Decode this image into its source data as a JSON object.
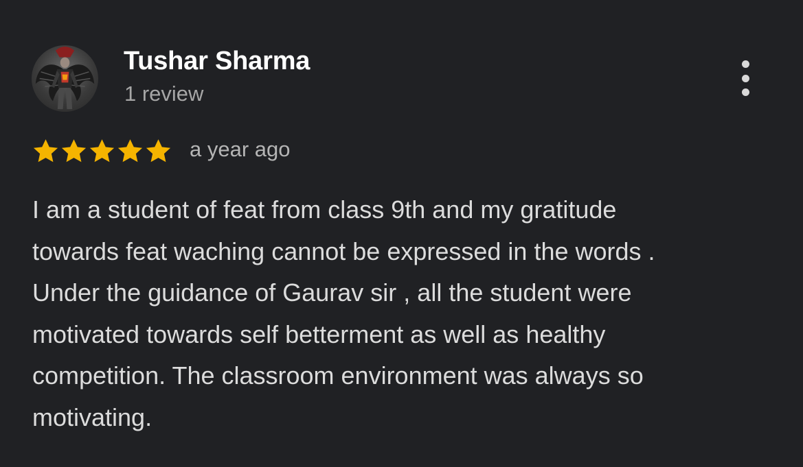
{
  "author": {
    "name": "Tushar Sharma",
    "review_count": "1 review"
  },
  "rating": {
    "stars": 5,
    "max_stars": 5,
    "star_color": "#f5b400"
  },
  "review": {
    "date": "a year ago",
    "lines": [
      "I am a student of feat from class 9th and my gratitude",
      "towards feat waching cannot be expressed in the words .",
      "Under the guidance of Gaurav sir , all the student were",
      "motivated towards self betterment as well as healthy",
      "competition. The classroom environment was always so",
      "motivating."
    ]
  },
  "icons": {
    "more": "more-vertical-icon",
    "star": "star-icon",
    "avatar": "avatar-image"
  },
  "colors": {
    "background": "#202124",
    "name": "#ffffff",
    "secondary": "#a6a6a6",
    "body": "#dcdcdc"
  }
}
